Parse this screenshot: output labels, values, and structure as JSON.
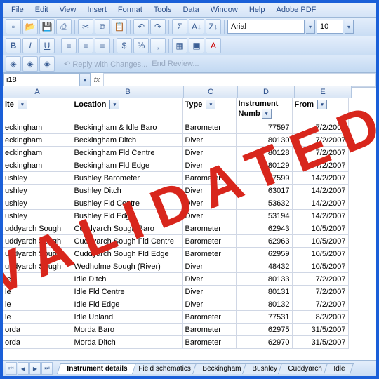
{
  "menu": [
    "File",
    "Edit",
    "View",
    "Insert",
    "Format",
    "Tools",
    "Data",
    "Window",
    "Help",
    "Adobe PDF"
  ],
  "font": {
    "name": "Arial",
    "size": "10"
  },
  "review": {
    "reply": "Reply with Changes...",
    "end": "End Review..."
  },
  "namebox": "i18",
  "cols": [
    "A",
    "B",
    "C",
    "D",
    "E"
  ],
  "headers": {
    "A": "ite",
    "B": "Location",
    "C": "Type",
    "D": "Instrument Number",
    "E": "From"
  },
  "rows": [
    {
      "a": "eckingham",
      "b": "Beckingham & Idle Baro",
      "c": "Barometer",
      "d": "77597",
      "e": "7/2/2007"
    },
    {
      "a": "eckingham",
      "b": "Beckingham Ditch",
      "c": "Diver",
      "d": "80130",
      "e": "7/2/2007"
    },
    {
      "a": "eckingham",
      "b": "Beckingham Fld Centre",
      "c": "Diver",
      "d": "80128",
      "e": "7/2/2007"
    },
    {
      "a": "eckingham",
      "b": "Beckingham Fld Edge",
      "c": "Diver",
      "d": "80129",
      "e": "7/2/2007"
    },
    {
      "a": "ushley",
      "b": "Bushley Barometer",
      "c": "Barometer",
      "d": "77599",
      "e": "14/2/2007"
    },
    {
      "a": "ushley",
      "b": "Bushley Ditch",
      "c": "Diver",
      "d": "63017",
      "e": "14/2/2007"
    },
    {
      "a": "ushley",
      "b": "Bushley Fld Centre",
      "c": "Diver",
      "d": "53632",
      "e": "14/2/2007"
    },
    {
      "a": "ushley",
      "b": "Bushley Fld Edge",
      "c": "Diver",
      "d": "53194",
      "e": "14/2/2007"
    },
    {
      "a": "uddyarch Sough",
      "b": "Cuddyarch Sough Baro",
      "c": "Barometer",
      "d": "62943",
      "e": "10/5/2007"
    },
    {
      "a": "uddyarch Sough",
      "b": "Cuddyarch Sough Fld Centre",
      "c": "Barometer",
      "d": "62963",
      "e": "10/5/2007"
    },
    {
      "a": "uddyarch Sough",
      "b": "Cuddyarch Sough Fld Edge",
      "c": "Barometer",
      "d": "62959",
      "e": "10/5/2007"
    },
    {
      "a": "uddyarch Sough",
      "b": "Wedholme Sough (River)",
      "c": "Diver",
      "d": "48432",
      "e": "10/5/2007"
    },
    {
      "a": "le",
      "b": "Idle Ditch",
      "c": "Diver",
      "d": "80133",
      "e": "7/2/2007"
    },
    {
      "a": "le",
      "b": "Idle Fld Centre",
      "c": "Diver",
      "d": "80131",
      "e": "7/2/2007"
    },
    {
      "a": "le",
      "b": "Idle Fld Edge",
      "c": "Diver",
      "d": "80132",
      "e": "7/2/2007"
    },
    {
      "a": "le",
      "b": "Idle Upland",
      "c": "Barometer",
      "d": "77531",
      "e": "8/2/2007"
    },
    {
      "a": "orda",
      "b": "Morda Baro",
      "c": "Barometer",
      "d": "62975",
      "e": "31/5/2007"
    },
    {
      "a": "orda",
      "b": "Morda Ditch",
      "c": "Barometer",
      "d": "62970",
      "e": "31/5/2007"
    }
  ],
  "tabs": [
    "Instrument details",
    "Field schematics",
    "Beckingham",
    "Bushley",
    "Cuddyarch",
    "Idle"
  ],
  "stamp": "VALIDATED"
}
